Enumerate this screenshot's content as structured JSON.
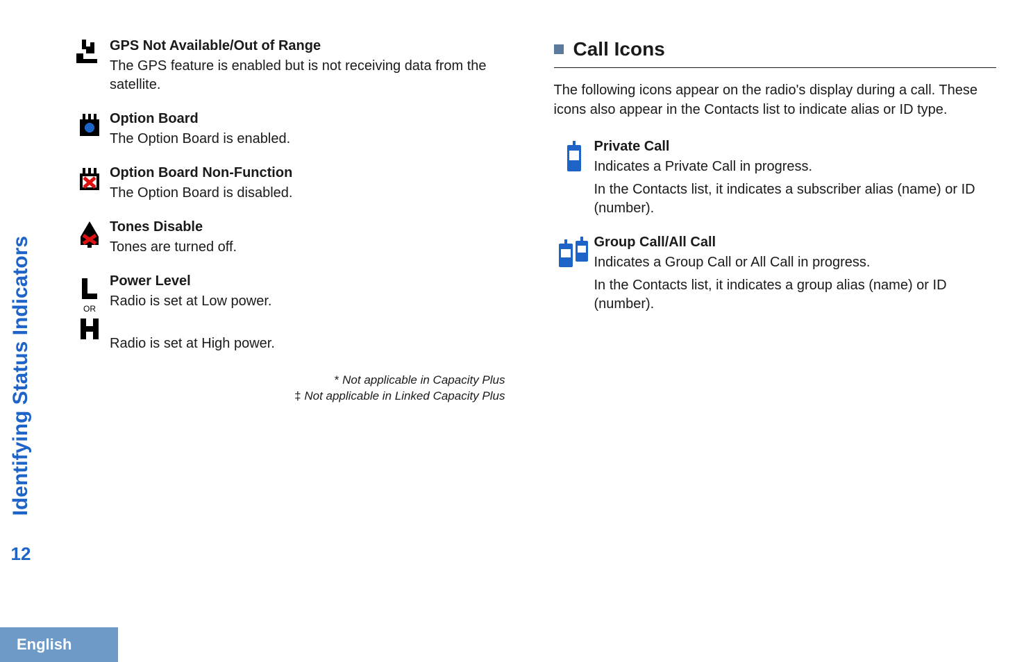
{
  "sidebar": {
    "label": "Identifying Status Indicators",
    "page_number": "12"
  },
  "footer": {
    "language": "English"
  },
  "left": {
    "entries": [
      {
        "title": "GPS Not Available/Out of Range",
        "desc": "The GPS feature is enabled but is not receiving data from the satellite."
      },
      {
        "title": "Option Board",
        "desc": "The Option Board is enabled."
      },
      {
        "title": "Option Board Non-Function",
        "desc": "The Option Board is disabled."
      },
      {
        "title": "Tones Disable",
        "desc": "Tones are turned off."
      },
      {
        "title": "Power Level",
        "desc_low": "Radio is set at Low power.",
        "or": "OR",
        "desc_high": "Radio is set at High power."
      }
    ],
    "footnotes": {
      "line1_marker": "*",
      "line1_text": " Not applicable in Capacity Plus",
      "line2_marker": "‡",
      "line2_text": " Not applicable in Linked Capacity Plus"
    }
  },
  "right": {
    "section_title": "Call Icons",
    "intro": "The following icons appear on the radio's display during a call. These icons also appear in the Contacts list to indicate alias or ID type.",
    "entries": [
      {
        "title": "Private Call",
        "desc1": "Indicates a Private Call in progress.",
        "desc2": "In the Contacts list, it indicates a subscriber alias (name) or ID (number)."
      },
      {
        "title": "Group Call/All Call",
        "desc1": "Indicates a Group Call or All Call in progress.",
        "desc2": "In the Contacts list, it indicates a group alias (name) or ID (number)."
      }
    ]
  }
}
